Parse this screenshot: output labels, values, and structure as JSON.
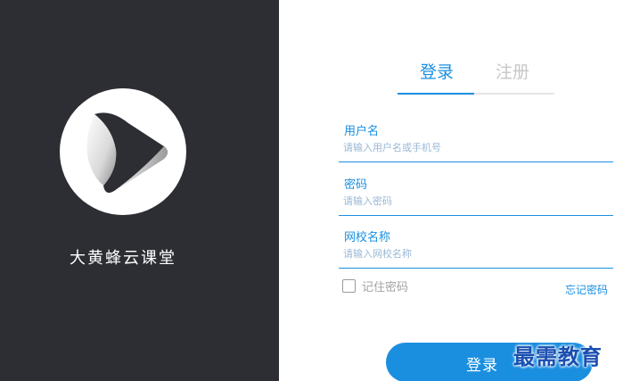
{
  "brand": {
    "app_name": "大黄蜂云课堂",
    "logo_icon": "play-circle-logo-icon",
    "panel_color": "#2d2e33"
  },
  "tabs": {
    "login_label": "登录",
    "register_label": "注册",
    "active": "login"
  },
  "form": {
    "username": {
      "label": "用户名",
      "placeholder": "请输入用户名或手机号",
      "value": ""
    },
    "password": {
      "label": "密码",
      "placeholder": "请输入密码",
      "value": ""
    },
    "school": {
      "label": "网校名称",
      "placeholder": "请输入网校名称",
      "value": ""
    }
  },
  "remember": {
    "label": "记住密码",
    "checked": false
  },
  "forgot_label": "忘记密码",
  "login_button_label": "登录",
  "watermark_text": "最需教育",
  "colors": {
    "accent": "#1a8fe0",
    "inactive": "#c7c7c7"
  }
}
